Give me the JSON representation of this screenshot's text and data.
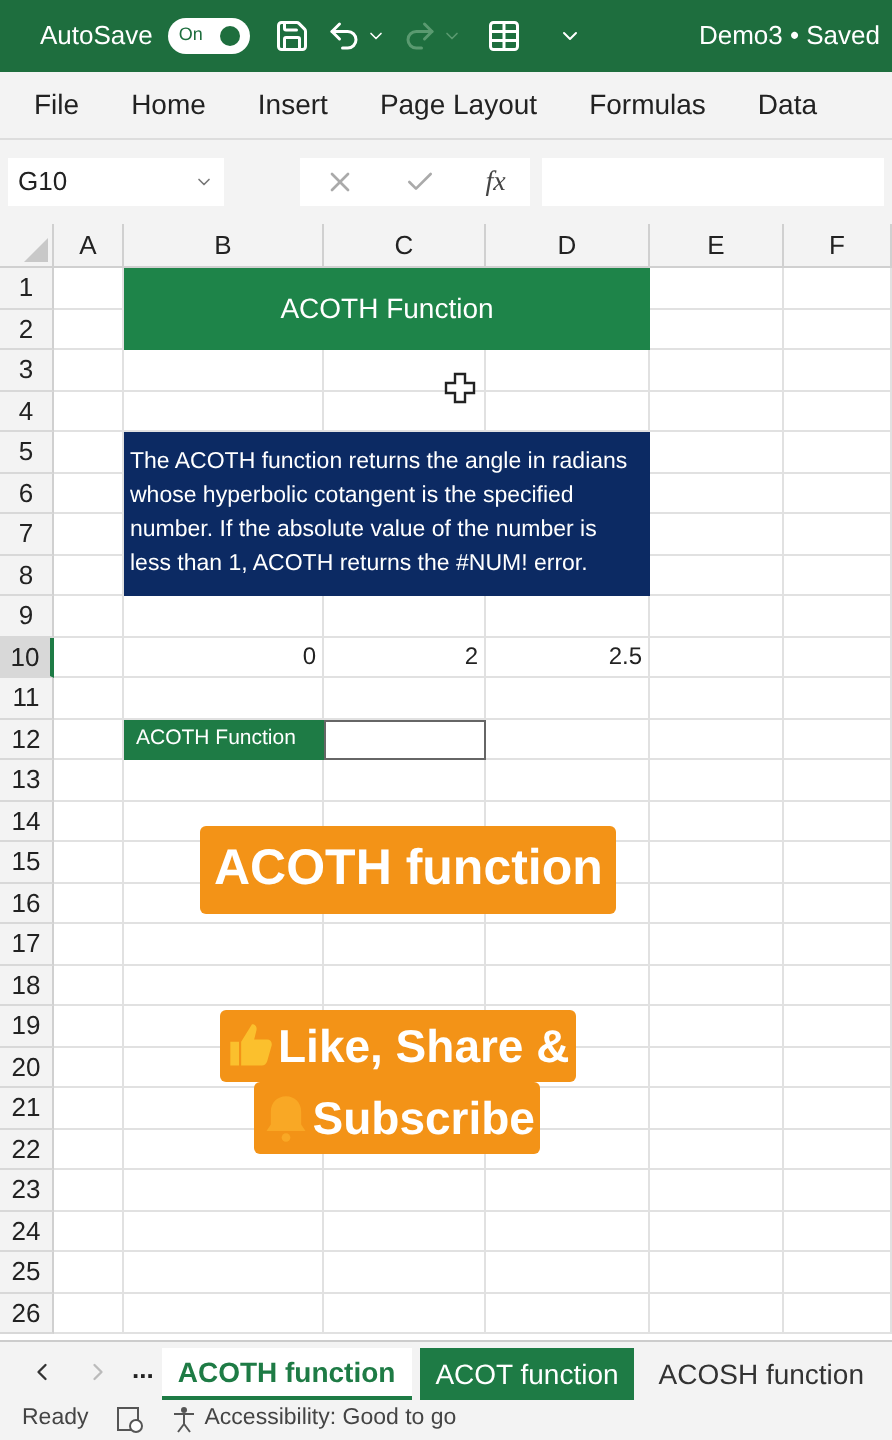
{
  "title_bar": {
    "autosave_label": "AutoSave",
    "autosave_toggle": {
      "label": "On",
      "on": true
    },
    "document": "Demo3 • Saved"
  },
  "ribbon_tabs": [
    "File",
    "Home",
    "Insert",
    "Page Layout",
    "Formulas",
    "Data"
  ],
  "formula_bar": {
    "name_box": "G10",
    "function_label": "fx"
  },
  "columns": [
    "A",
    "B",
    "C",
    "D",
    "E",
    "F"
  ],
  "rows": [
    {
      "label": "1",
      "selected": false
    },
    {
      "label": "2",
      "selected": false
    },
    {
      "label": "3",
      "selected": false
    },
    {
      "label": "4",
      "selected": false
    },
    {
      "label": "5",
      "selected": false
    },
    {
      "label": "6",
      "selected": false
    },
    {
      "label": "7",
      "selected": false
    },
    {
      "label": "8",
      "selected": false
    },
    {
      "label": "9",
      "selected": false
    },
    {
      "label": "10",
      "selected": true
    },
    {
      "label": "11",
      "selected": false
    },
    {
      "label": "12",
      "selected": false
    },
    {
      "label": "13",
      "selected": false
    },
    {
      "label": "14",
      "selected": false
    },
    {
      "label": "15",
      "selected": false
    },
    {
      "label": "16",
      "selected": false
    },
    {
      "label": "17",
      "selected": false
    },
    {
      "label": "18",
      "selected": false
    },
    {
      "label": "19",
      "selected": false
    },
    {
      "label": "20",
      "selected": false
    },
    {
      "label": "21",
      "selected": false
    },
    {
      "label": "22",
      "selected": false
    },
    {
      "label": "23",
      "selected": false
    },
    {
      "label": "24",
      "selected": false
    },
    {
      "label": "25",
      "selected": false
    },
    {
      "label": "26",
      "selected": false
    }
  ],
  "cells": {
    "B1:D2": {
      "kind": "title",
      "text": "ACOTH Function"
    },
    "B5:D8": {
      "kind": "note",
      "text": "The ACOTH function returns the angle in radians whose hyperbolic cotangent is the specified number. If the absolute value of the number is less than 1, ACOTH returns the #NUM! error."
    },
    "B10": {
      "kind": "number",
      "text": "0"
    },
    "C10": {
      "kind": "number",
      "text": "2"
    },
    "D10": {
      "kind": "number",
      "text": "2.5"
    },
    "B12": {
      "kind": "label",
      "text": "ACOTH Function"
    },
    "C12": {
      "kind": "outlined"
    }
  },
  "overlay": {
    "caption": "ACOTH function",
    "call_to_action": [
      "Like, Share &",
      "Subscribe"
    ]
  },
  "sheet_tabs": {
    "more": "...",
    "tabs": [
      {
        "label": "ACOTH function",
        "selected": true
      },
      {
        "label": "ACOT function",
        "selected": false
      },
      {
        "label": "ACOSH function",
        "selected": false
      }
    ]
  },
  "status_bar": {
    "ready": "Ready",
    "accessibility": "Accessibility: Good to go"
  }
}
